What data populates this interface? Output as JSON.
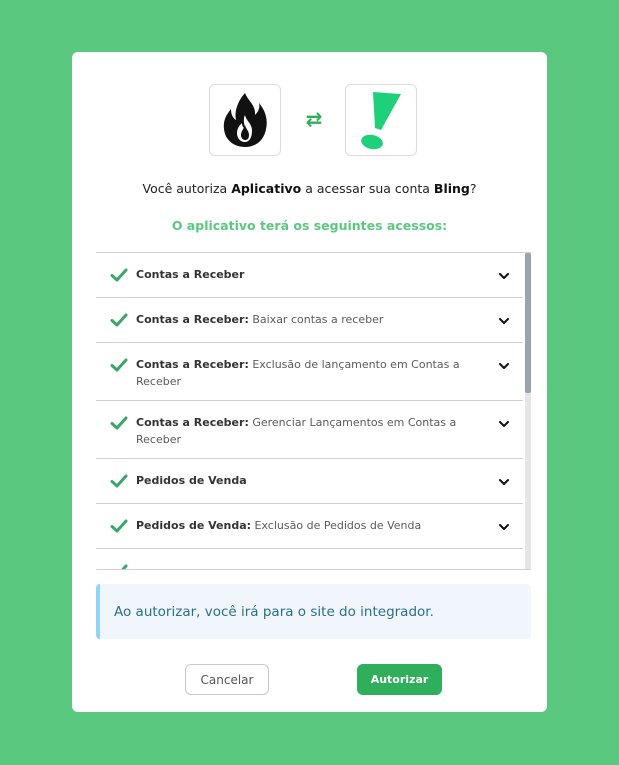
{
  "header": {
    "question_prefix": "Você autoriza ",
    "app_name": "Aplicativo",
    "question_middle": " a acessar sua conta ",
    "account_name": "Bling",
    "question_suffix": "?",
    "subtitle": "O aplicativo terá os seguintes acessos:"
  },
  "icons": {
    "left_logo": "fire-icon",
    "swap": "swap-arrows-icon",
    "right_logo": "exclamation-logo-icon"
  },
  "permissions": [
    {
      "title": "Contas a Receber",
      "detail": ""
    },
    {
      "title": "Contas a Receber:",
      "detail": " Baixar contas a receber"
    },
    {
      "title": "Contas a Receber:",
      "detail": " Exclusão de lançamento em Contas a Receber"
    },
    {
      "title": "Contas a Receber:",
      "detail": " Gerenciar Lançamentos em Contas a Receber"
    },
    {
      "title": "Pedidos de Venda",
      "detail": ""
    },
    {
      "title": "Pedidos de Venda:",
      "detail": " Exclusão de Pedidos de Venda"
    },
    {
      "title": "",
      "detail": ""
    }
  ],
  "info": {
    "message": "Ao autorizar, você irá para o site do integrador."
  },
  "buttons": {
    "cancel": "Cancelar",
    "authorize": "Autorizar"
  },
  "colors": {
    "background": "#5bc87f",
    "accent": "#2fae5c",
    "info_border": "#8fd6f4"
  }
}
